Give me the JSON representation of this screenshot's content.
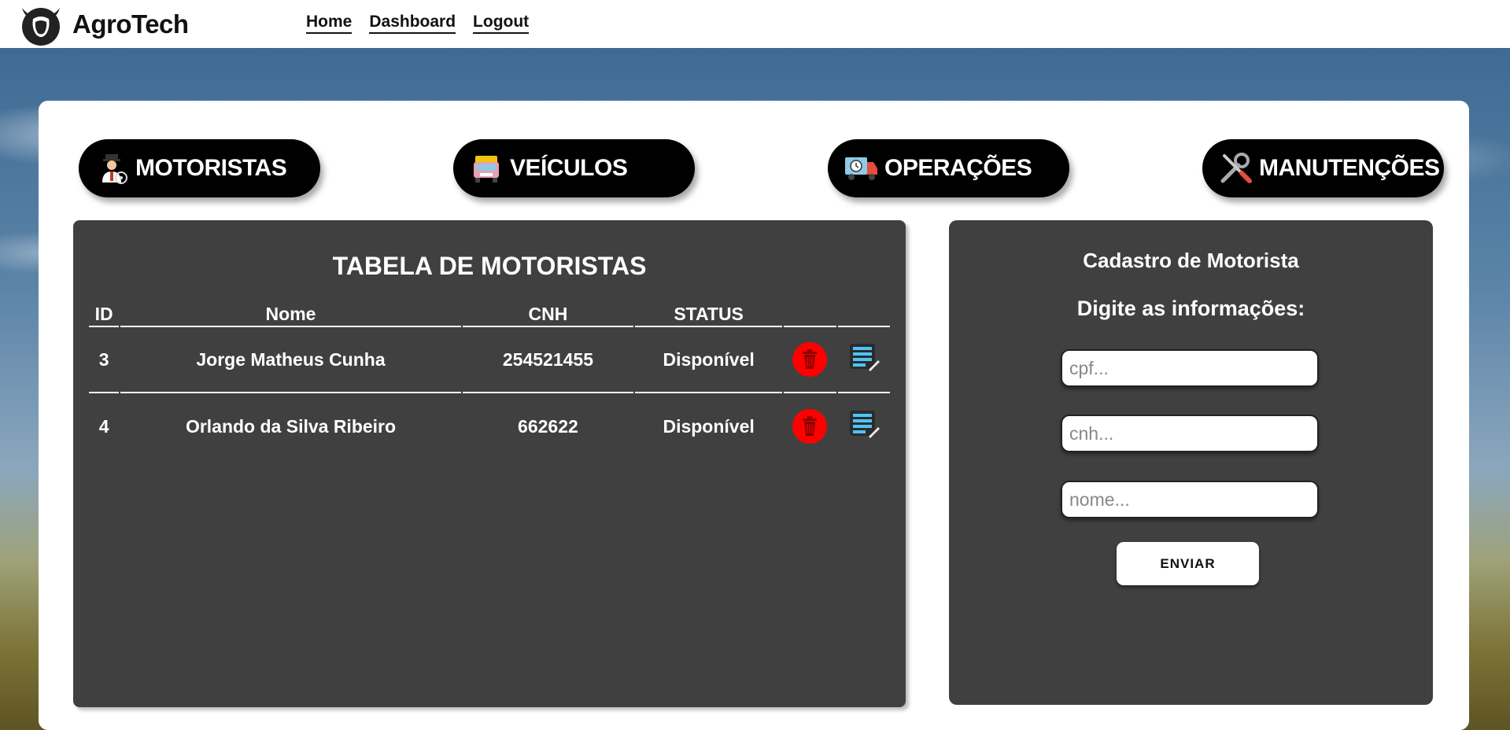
{
  "header": {
    "brand": "AgroTech",
    "nav": [
      {
        "label": "Home"
      },
      {
        "label": "Dashboard"
      },
      {
        "label": "Logout"
      }
    ]
  },
  "tabs": [
    {
      "label": "MOTORISTAS",
      "icon": "driver-icon"
    },
    {
      "label": "VEÍCULOS",
      "icon": "truck-icon"
    },
    {
      "label": "OPERAÇÕES",
      "icon": "delivery-truck-icon"
    },
    {
      "label": "MANUTENÇÕES",
      "icon": "tools-icon"
    }
  ],
  "table": {
    "title": "TABELA DE MOTORISTAS",
    "columns": [
      "ID",
      "Nome",
      "CNH",
      "STATUS",
      "",
      ""
    ],
    "rows": [
      {
        "id": "3",
        "nome": "Jorge Matheus Cunha",
        "cnh": "254521455",
        "status": "Disponível"
      },
      {
        "id": "4",
        "nome": "Orlando da Silva Ribeiro",
        "cnh": "662622",
        "status": "Disponível"
      }
    ]
  },
  "form": {
    "title": "Cadastro de Motorista",
    "subtitle": "Digite as informações:",
    "fields": [
      {
        "placeholder": "cpf...",
        "value": ""
      },
      {
        "placeholder": "cnh...",
        "value": ""
      },
      {
        "placeholder": "nome...",
        "value": ""
      }
    ],
    "submit_label": "ENVIAR"
  },
  "colors": {
    "panel": "#404040",
    "tab_bg": "#000000",
    "delete": "#ff0000",
    "text": "#ffffff"
  }
}
